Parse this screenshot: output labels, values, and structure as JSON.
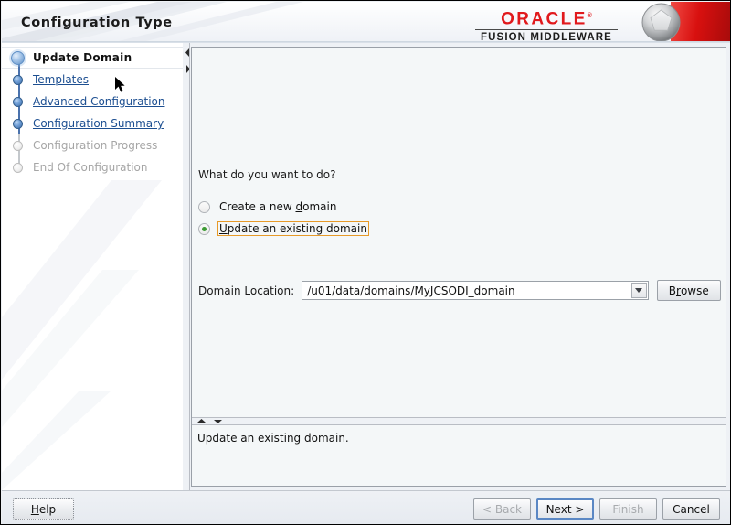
{
  "window": {
    "title": "Configuration Type"
  },
  "branding": {
    "oracle": "ORACLE",
    "registered": "®",
    "product": "FUSION MIDDLEWARE",
    "logo_icon": "oracle-sphere-pentagon-logo"
  },
  "sidebar": {
    "steps": [
      {
        "label": "Update Domain",
        "state": "current"
      },
      {
        "label": "Templates",
        "state": "link"
      },
      {
        "label": "Advanced Configuration",
        "state": "link"
      },
      {
        "label": "Configuration Summary",
        "state": "link"
      },
      {
        "label": "Configuration Progress",
        "state": "disabled"
      },
      {
        "label": "End Of Configuration",
        "state": "disabled"
      }
    ]
  },
  "main": {
    "question": "What do you want to do?",
    "options": [
      {
        "pre": "Create a new ",
        "mnemonic": "d",
        "post": "omain",
        "selected": false,
        "focused": false
      },
      {
        "pre": "",
        "mnemonic": "U",
        "post": "pdate an existing domain",
        "selected": true,
        "focused": true
      }
    ],
    "domain_location": {
      "label": "Domain Location:",
      "value": "/u01/data/domains/MyJCSODI_domain",
      "dropdown_icon": "chevron-down-icon"
    },
    "browse_button": {
      "pre": "B",
      "mnemonic": "r",
      "post": "owse"
    }
  },
  "description": {
    "text": "Update an existing domain."
  },
  "footer": {
    "help": {
      "pre": "",
      "mnemonic": "H",
      "post": "elp"
    },
    "back": {
      "label": "< Back",
      "enabled": false,
      "mnemonic": "B"
    },
    "next": {
      "label": "Next >",
      "enabled": true,
      "default": true,
      "mnemonic": "N"
    },
    "finish": {
      "label": "Finish",
      "enabled": false,
      "mnemonic": "F"
    },
    "cancel": {
      "label": "Cancel",
      "enabled": true
    }
  },
  "colors": {
    "oracle_red": "#e1191c",
    "link_blue": "#1d4f91",
    "focus_orange": "#e79a28",
    "radio_green": "#3c9b34",
    "default_button_blue": "#5a87c4"
  }
}
